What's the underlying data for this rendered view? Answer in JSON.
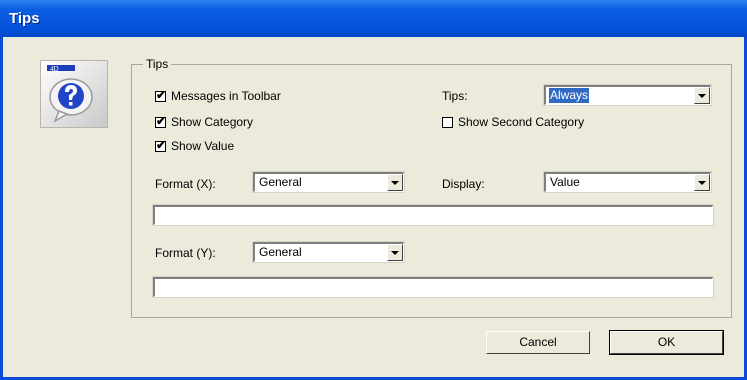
{
  "window": {
    "title": "Tips"
  },
  "group": {
    "label": "Tips"
  },
  "checkboxes": {
    "messages_in_toolbar": {
      "label": "Messages in Toolbar",
      "checked": true
    },
    "show_category": {
      "label": "Show Category",
      "checked": true
    },
    "show_value": {
      "label": "Show Value",
      "checked": true
    },
    "show_second_category": {
      "label": "Show Second Category",
      "checked": false
    }
  },
  "tips": {
    "label": "Tips:",
    "value": "Always"
  },
  "format_x": {
    "label": "Format (X):",
    "value": "General",
    "text": ""
  },
  "display": {
    "label": "Display:",
    "value": "Value"
  },
  "format_y": {
    "label": "Format (Y):",
    "value": "General",
    "text": ""
  },
  "buttons": {
    "cancel": "Cancel",
    "ok": "OK"
  },
  "logo": {
    "icon": "help-question-icon",
    "badge_text": "4D"
  },
  "check_glyph": "✔",
  "colors": {
    "title_bar": "#0654de",
    "dialog_bg": "#eceadb",
    "selection": "#316ac5"
  }
}
